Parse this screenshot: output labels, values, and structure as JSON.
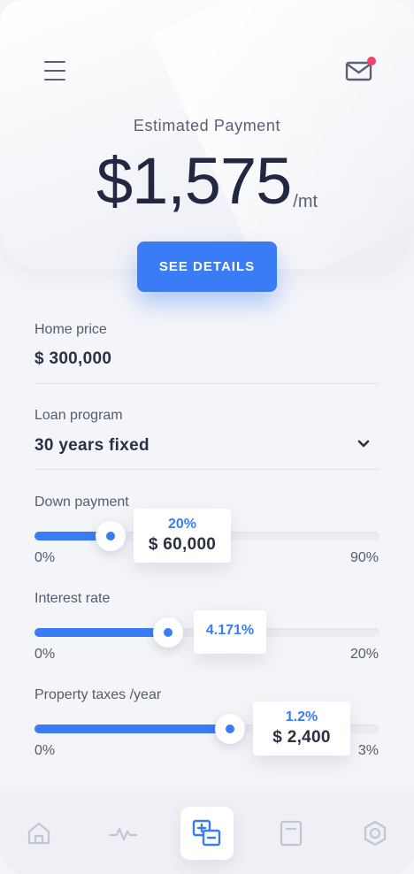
{
  "header": {
    "label": "Estimated Payment",
    "amount": "$1,575",
    "unit": "/mt",
    "cta": "SEE DETAILS",
    "has_notification": true
  },
  "form": {
    "home_price": {
      "label": "Home price",
      "value": "$ 300,000"
    },
    "loan_program": {
      "label": "Loan program",
      "value": "30 years fixed"
    },
    "down_payment": {
      "label": "Down payment",
      "percent": "20%",
      "amount": "$ 60,000",
      "min": "0%",
      "max": "90%",
      "level": 0.22
    },
    "interest_rate": {
      "label": "Interest rate",
      "percent": "4.171%",
      "min": "0%",
      "max": "20%",
      "level": 0.39
    },
    "property_taxes": {
      "label": "Property taxes /year",
      "percent": "1.2%",
      "amount": "$ 2,400",
      "min": "0%",
      "max": "3%",
      "level": 0.57
    }
  },
  "nav": {
    "items": [
      {
        "icon": "home-icon",
        "active": false
      },
      {
        "icon": "activity-icon",
        "active": false
      },
      {
        "icon": "calculator-icon",
        "active": true
      },
      {
        "icon": "document-icon",
        "active": false
      },
      {
        "icon": "settings-icon",
        "active": false
      }
    ]
  },
  "colors": {
    "accent": "#3a7bf6",
    "badge": "#f0436a",
    "background": "#f4f5f9",
    "text": "#2b3042"
  }
}
